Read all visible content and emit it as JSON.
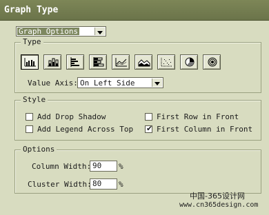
{
  "window": {
    "title": "Graph Type"
  },
  "panel_select": {
    "value": "Graph Options"
  },
  "type_section": {
    "title": "Type",
    "buttons": [
      {
        "icon": "grouped-column-icon",
        "selected": true
      },
      {
        "icon": "stacked-column-icon"
      },
      {
        "icon": "grouped-bar-icon"
      },
      {
        "icon": "stacked-bar-icon"
      },
      {
        "icon": "line-graph-icon"
      },
      {
        "icon": "area-graph-icon"
      },
      {
        "icon": "scatter-graph-icon"
      },
      {
        "icon": "pie-graph-icon"
      },
      {
        "icon": "radar-graph-icon"
      }
    ],
    "value_axis": {
      "label": "Value Axis:",
      "value": "On Left Side"
    }
  },
  "style_section": {
    "title": "Style",
    "add_drop_shadow": {
      "label": "Add Drop Shadow",
      "checked": false
    },
    "add_legend_across_top": {
      "label": "Add Legend Across Top",
      "checked": false
    },
    "first_row_in_front": {
      "label": "First Row in Front",
      "checked": false
    },
    "first_column_in_front": {
      "label": "First Column in Front",
      "checked": true
    }
  },
  "options_section": {
    "title": "Options",
    "column_width": {
      "label": "Column Width:",
      "value": "90",
      "unit": "%"
    },
    "cluster_width": {
      "label": "Cluster Width:",
      "value": "80",
      "unit": "%"
    }
  },
  "watermark": {
    "site_cn": "中国-365设计网",
    "url": "www.cn365design.com"
  },
  "check_glyph": "✔"
}
